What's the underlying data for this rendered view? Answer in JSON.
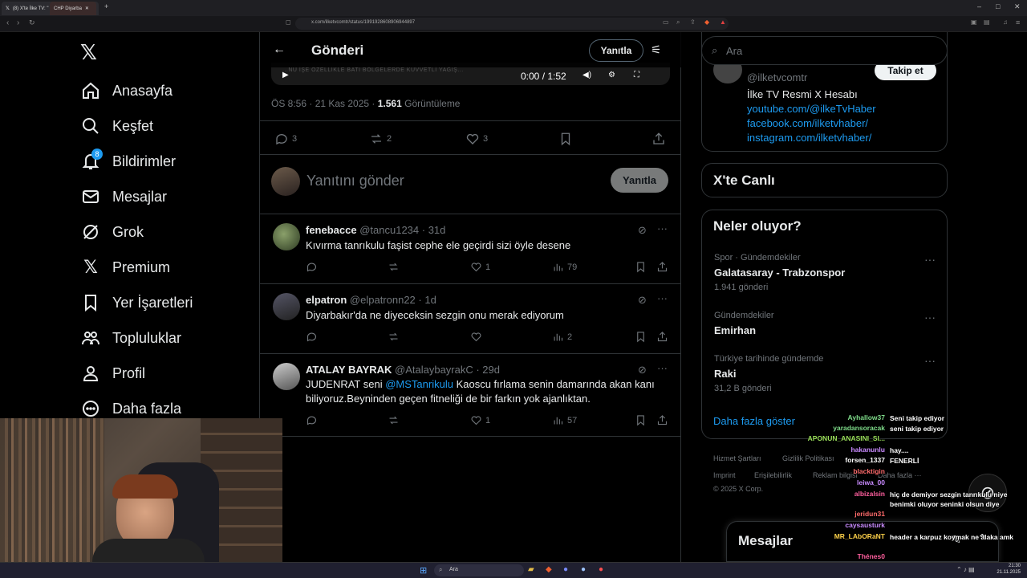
{
  "browser": {
    "tabs": [
      {
        "label": "(8) X'te İlke TV: \"",
        "active": true
      },
      {
        "label": "CHP Diyarba",
        "active": false
      }
    ],
    "url": "x.com/ilketvcomtr/status/1991928608906944897",
    "clock": {
      "time": "21:30",
      "date": "21.11.2025"
    }
  },
  "nav": {
    "items": [
      {
        "label": "Anasayfa",
        "icon": "home-icon"
      },
      {
        "label": "Keşfet",
        "icon": "search-icon"
      },
      {
        "label": "Bildirimler",
        "icon": "bell-icon",
        "badge": "8"
      },
      {
        "label": "Mesajlar",
        "icon": "mail-icon"
      },
      {
        "label": "Grok",
        "icon": "grok-icon"
      },
      {
        "label": "Premium",
        "icon": "x-logo-icon"
      },
      {
        "label": "Yer İşaretleri",
        "icon": "bookmark-icon"
      },
      {
        "label": "Topluluklar",
        "icon": "people-icon"
      },
      {
        "label": "Profil",
        "icon": "person-icon"
      },
      {
        "label": "Daha fazla",
        "icon": "more-circle-icon"
      }
    ]
  },
  "post": {
    "header_title": "Gönderi",
    "header_reply_button": "Yanıtla",
    "video_time": "0:00 / 1:52",
    "video_overlay_text": "...NU İŞE ÖZELLİKLE BATI BÖLGELERDE KUVVETLİ YAĞIŞ...",
    "meta_time": "ÖS 8:56 · 21 Kas 2025 · ",
    "meta_views": "1.561",
    "meta_views_label": " Görüntüleme",
    "stats": {
      "replies": "3",
      "reposts": "2",
      "likes": "3"
    },
    "compose_placeholder": "Yanıtını gönder",
    "compose_button": "Yanıtla"
  },
  "replies": [
    {
      "name": "fenebacce",
      "handle": "@tancu1234 · 31d",
      "text": "Kıvırma tanrıkulu faşist cephe ele geçirdi sizi öyle desene",
      "likes": "1",
      "views": "79"
    },
    {
      "name": "elpatron",
      "handle": "@elpatronn22 · 1d",
      "text": "Diyarbakır'da ne diyeceksin sezgin onu merak ediyorum",
      "likes": "",
      "views": "2"
    },
    {
      "name": "ATALAY BAYRAK",
      "handle": "@AtalaybayrakC · 29d",
      "text_pre": "JUDENRAT seni ",
      "mention": "@MSTanrikulu",
      "text_post": " Kaoscu fırlama senin damarında akan kanı biliyoruz.Beyninden geçen fitneliği de bir farkın yok ajanlıktan.",
      "likes": "1",
      "views": "57"
    }
  ],
  "right": {
    "search_placeholder": "Ara",
    "profile": {
      "handle": "@ilketvcomtr",
      "follow_button": "Takip et",
      "bio": "İlke TV Resmi X Hesabı",
      "links": [
        "youtube.com/@ilkeTvHaber",
        "facebook.com/ilketvhaber/",
        "instagram.com/ilketvhaber/"
      ]
    },
    "live_title": "X'te Canlı",
    "trends_title": "Neler oluyor?",
    "trends": [
      {
        "category": "Spor · Gündemdekiler",
        "title": "Galatasaray - Trabzonspor",
        "count": "1.941 gönderi"
      },
      {
        "category": "Gündemdekiler",
        "title": "Emirhan",
        "count": ""
      },
      {
        "category": "Türkiye tarihinde gündemde",
        "title": "Raki",
        "count": "31,2 B gönderi"
      }
    ],
    "show_more": "Daha fazla göster",
    "footer": [
      "Hizmet Şartları",
      "Gizlilik Politikası",
      "Imprint",
      "Erişilebilirlik",
      "Reklam bilgisi",
      "Daha fazla ···",
      "© 2025 X Corp."
    ],
    "messages_title": "Mesajlar"
  },
  "chat": [
    {
      "user": "Ayhallow37",
      "color": "#7fdc8a",
      "msg": "Seni takip ediyor"
    },
    {
      "user": "yaradansoracak",
      "color": "#7fdc8a",
      "msg": "seni takip ediyor"
    },
    {
      "user": "APONUN_ANASINI_SI...",
      "color": "#9be05a",
      "msg": ""
    },
    {
      "user": "hakanunlu",
      "color": "#c98bff",
      "msg": "hay...."
    },
    {
      "user": "forsen_1337",
      "color": "#ffffff",
      "msg": "FENERLİ"
    },
    {
      "user": "blacktigin",
      "color": "#ff6b6b",
      "msg": ""
    },
    {
      "user": "leiwa_00",
      "color": "#c98bff",
      "msg": ""
    },
    {
      "user": "albizalsin",
      "color": "#ff5f9e",
      "msg": "hiç de demiyor sezgin tanrıkulu niye benimki oluyor seninki olsun diye"
    },
    {
      "user": "jeridun31",
      "color": "#ff6b6b",
      "msg": ""
    },
    {
      "user": "caysausturk",
      "color": "#c98bff",
      "msg": ""
    },
    {
      "user": "MR_LAbORaNT",
      "color": "#ffd24a",
      "msg": "header a karpuz koymak ne alaka amk"
    },
    {
      "user": "Thénes0",
      "color": "#ff5f9e",
      "msg": ""
    }
  ]
}
